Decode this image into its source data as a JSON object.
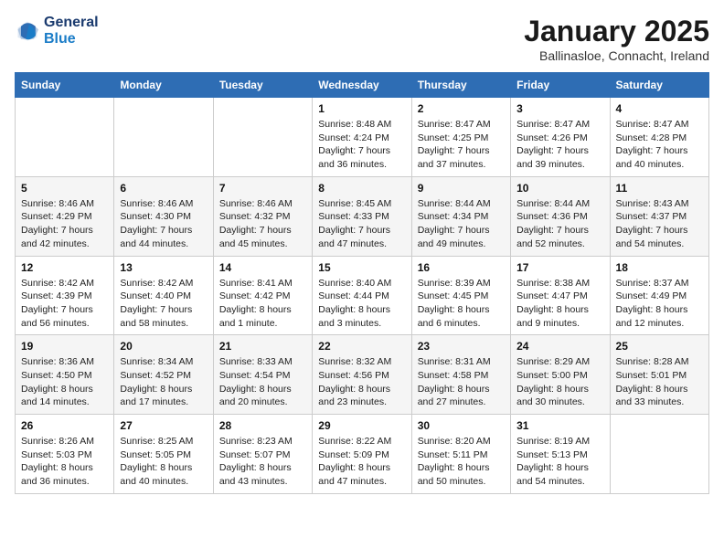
{
  "logo": {
    "line1": "General",
    "line2": "Blue"
  },
  "title": "January 2025",
  "location": "Ballinasloe, Connacht, Ireland",
  "days_of_week": [
    "Sunday",
    "Monday",
    "Tuesday",
    "Wednesday",
    "Thursday",
    "Friday",
    "Saturday"
  ],
  "weeks": [
    [
      {
        "day": "",
        "sunrise": "",
        "sunset": "",
        "daylight": ""
      },
      {
        "day": "",
        "sunrise": "",
        "sunset": "",
        "daylight": ""
      },
      {
        "day": "",
        "sunrise": "",
        "sunset": "",
        "daylight": ""
      },
      {
        "day": "1",
        "sunrise": "Sunrise: 8:48 AM",
        "sunset": "Sunset: 4:24 PM",
        "daylight": "Daylight: 7 hours and 36 minutes."
      },
      {
        "day": "2",
        "sunrise": "Sunrise: 8:47 AM",
        "sunset": "Sunset: 4:25 PM",
        "daylight": "Daylight: 7 hours and 37 minutes."
      },
      {
        "day": "3",
        "sunrise": "Sunrise: 8:47 AM",
        "sunset": "Sunset: 4:26 PM",
        "daylight": "Daylight: 7 hours and 39 minutes."
      },
      {
        "day": "4",
        "sunrise": "Sunrise: 8:47 AM",
        "sunset": "Sunset: 4:28 PM",
        "daylight": "Daylight: 7 hours and 40 minutes."
      }
    ],
    [
      {
        "day": "5",
        "sunrise": "Sunrise: 8:46 AM",
        "sunset": "Sunset: 4:29 PM",
        "daylight": "Daylight: 7 hours and 42 minutes."
      },
      {
        "day": "6",
        "sunrise": "Sunrise: 8:46 AM",
        "sunset": "Sunset: 4:30 PM",
        "daylight": "Daylight: 7 hours and 44 minutes."
      },
      {
        "day": "7",
        "sunrise": "Sunrise: 8:46 AM",
        "sunset": "Sunset: 4:32 PM",
        "daylight": "Daylight: 7 hours and 45 minutes."
      },
      {
        "day": "8",
        "sunrise": "Sunrise: 8:45 AM",
        "sunset": "Sunset: 4:33 PM",
        "daylight": "Daylight: 7 hours and 47 minutes."
      },
      {
        "day": "9",
        "sunrise": "Sunrise: 8:44 AM",
        "sunset": "Sunset: 4:34 PM",
        "daylight": "Daylight: 7 hours and 49 minutes."
      },
      {
        "day": "10",
        "sunrise": "Sunrise: 8:44 AM",
        "sunset": "Sunset: 4:36 PM",
        "daylight": "Daylight: 7 hours and 52 minutes."
      },
      {
        "day": "11",
        "sunrise": "Sunrise: 8:43 AM",
        "sunset": "Sunset: 4:37 PM",
        "daylight": "Daylight: 7 hours and 54 minutes."
      }
    ],
    [
      {
        "day": "12",
        "sunrise": "Sunrise: 8:42 AM",
        "sunset": "Sunset: 4:39 PM",
        "daylight": "Daylight: 7 hours and 56 minutes."
      },
      {
        "day": "13",
        "sunrise": "Sunrise: 8:42 AM",
        "sunset": "Sunset: 4:40 PM",
        "daylight": "Daylight: 7 hours and 58 minutes."
      },
      {
        "day": "14",
        "sunrise": "Sunrise: 8:41 AM",
        "sunset": "Sunset: 4:42 PM",
        "daylight": "Daylight: 8 hours and 1 minute."
      },
      {
        "day": "15",
        "sunrise": "Sunrise: 8:40 AM",
        "sunset": "Sunset: 4:44 PM",
        "daylight": "Daylight: 8 hours and 3 minutes."
      },
      {
        "day": "16",
        "sunrise": "Sunrise: 8:39 AM",
        "sunset": "Sunset: 4:45 PM",
        "daylight": "Daylight: 8 hours and 6 minutes."
      },
      {
        "day": "17",
        "sunrise": "Sunrise: 8:38 AM",
        "sunset": "Sunset: 4:47 PM",
        "daylight": "Daylight: 8 hours and 9 minutes."
      },
      {
        "day": "18",
        "sunrise": "Sunrise: 8:37 AM",
        "sunset": "Sunset: 4:49 PM",
        "daylight": "Daylight: 8 hours and 12 minutes."
      }
    ],
    [
      {
        "day": "19",
        "sunrise": "Sunrise: 8:36 AM",
        "sunset": "Sunset: 4:50 PM",
        "daylight": "Daylight: 8 hours and 14 minutes."
      },
      {
        "day": "20",
        "sunrise": "Sunrise: 8:34 AM",
        "sunset": "Sunset: 4:52 PM",
        "daylight": "Daylight: 8 hours and 17 minutes."
      },
      {
        "day": "21",
        "sunrise": "Sunrise: 8:33 AM",
        "sunset": "Sunset: 4:54 PM",
        "daylight": "Daylight: 8 hours and 20 minutes."
      },
      {
        "day": "22",
        "sunrise": "Sunrise: 8:32 AM",
        "sunset": "Sunset: 4:56 PM",
        "daylight": "Daylight: 8 hours and 23 minutes."
      },
      {
        "day": "23",
        "sunrise": "Sunrise: 8:31 AM",
        "sunset": "Sunset: 4:58 PM",
        "daylight": "Daylight: 8 hours and 27 minutes."
      },
      {
        "day": "24",
        "sunrise": "Sunrise: 8:29 AM",
        "sunset": "Sunset: 5:00 PM",
        "daylight": "Daylight: 8 hours and 30 minutes."
      },
      {
        "day": "25",
        "sunrise": "Sunrise: 8:28 AM",
        "sunset": "Sunset: 5:01 PM",
        "daylight": "Daylight: 8 hours and 33 minutes."
      }
    ],
    [
      {
        "day": "26",
        "sunrise": "Sunrise: 8:26 AM",
        "sunset": "Sunset: 5:03 PM",
        "daylight": "Daylight: 8 hours and 36 minutes."
      },
      {
        "day": "27",
        "sunrise": "Sunrise: 8:25 AM",
        "sunset": "Sunset: 5:05 PM",
        "daylight": "Daylight: 8 hours and 40 minutes."
      },
      {
        "day": "28",
        "sunrise": "Sunrise: 8:23 AM",
        "sunset": "Sunset: 5:07 PM",
        "daylight": "Daylight: 8 hours and 43 minutes."
      },
      {
        "day": "29",
        "sunrise": "Sunrise: 8:22 AM",
        "sunset": "Sunset: 5:09 PM",
        "daylight": "Daylight: 8 hours and 47 minutes."
      },
      {
        "day": "30",
        "sunrise": "Sunrise: 8:20 AM",
        "sunset": "Sunset: 5:11 PM",
        "daylight": "Daylight: 8 hours and 50 minutes."
      },
      {
        "day": "31",
        "sunrise": "Sunrise: 8:19 AM",
        "sunset": "Sunset: 5:13 PM",
        "daylight": "Daylight: 8 hours and 54 minutes."
      },
      {
        "day": "",
        "sunrise": "",
        "sunset": "",
        "daylight": ""
      }
    ]
  ]
}
